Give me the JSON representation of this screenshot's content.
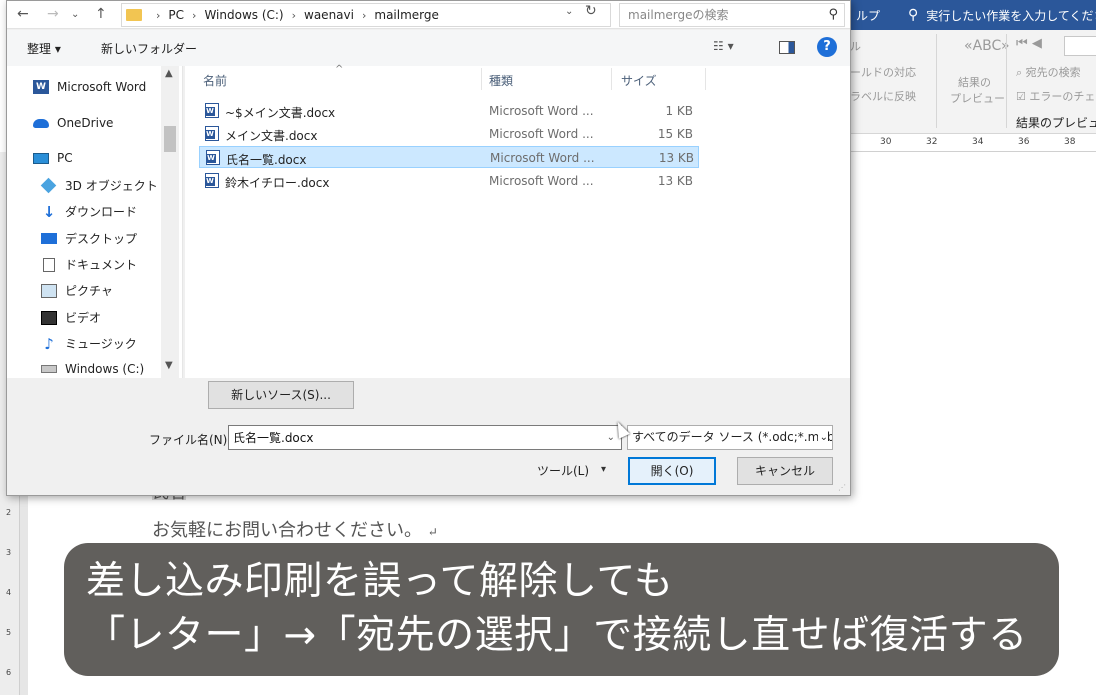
{
  "word": {
    "title_help": "ルプ",
    "tell_me": "実行したい作業を入力してくださ",
    "ribbon": {
      "rules": "ル",
      "match_fields": "ールドの対応",
      "update_labels": "ラベルに反映",
      "preview_results_l1": "結果の",
      "preview_results_l2": "プレビュー",
      "find_recipient": "宛先の検索",
      "check_errors": "エラーのチェ",
      "group_label": "結果のプレビュー"
    },
    "ruler": [
      "30",
      "32",
      "34",
      "36",
      "38"
    ],
    "vertical_ruler": [
      "2",
      "3",
      "4",
      "5",
      "6"
    ],
    "doc_line1_field": "氏名",
    "doc_line2": "お気軽にお問い合わせください。"
  },
  "dialog": {
    "breadcrumb": [
      "PC",
      "Windows (C:)",
      "waenavi",
      "mailmerge"
    ],
    "search_placeholder": "mailmergeの検索",
    "toolbar": {
      "organize": "整理 ▾",
      "new_folder": "新しいフォルダー",
      "view": "☷ ▾"
    },
    "nav_pane": [
      {
        "label": "Microsoft Word",
        "icon": "word-icon"
      },
      {
        "label": "OneDrive",
        "icon": "cloud-icon"
      },
      {
        "label": "PC",
        "icon": "pc-icon"
      },
      {
        "label": "3D オブジェクト",
        "icon": "cube-icon"
      },
      {
        "label": "ダウンロード",
        "icon": "download-icon"
      },
      {
        "label": "デスクトップ",
        "icon": "desktop-icon"
      },
      {
        "label": "ドキュメント",
        "icon": "document-icon"
      },
      {
        "label": "ピクチャ",
        "icon": "picture-icon"
      },
      {
        "label": "ビデオ",
        "icon": "video-icon"
      },
      {
        "label": "ミュージック",
        "icon": "music-icon"
      },
      {
        "label": "Windows (C:)",
        "icon": "drive-icon"
      }
    ],
    "columns": {
      "name": "名前",
      "type": "種類",
      "size": "サイズ"
    },
    "files": [
      {
        "name": "~$メイン文書.docx",
        "type": "Microsoft Word ...",
        "size": "1 KB",
        "selected": false
      },
      {
        "name": "メイン文書.docx",
        "type": "Microsoft Word ...",
        "size": "15 KB",
        "selected": false
      },
      {
        "name": "氏名一覧.docx",
        "type": "Microsoft Word ...",
        "size": "13 KB",
        "selected": true
      },
      {
        "name": "鈴木イチロー.docx",
        "type": "Microsoft Word ...",
        "size": "13 KB",
        "selected": false
      }
    ],
    "new_source_button": "新しいソース(S)...",
    "filename_label": "ファイル名(N):",
    "filename_value": "氏名一覧.docx",
    "filetype": "すべてのデータ ソース (*.odc;*.mdb",
    "tools": "ツール(L)",
    "open_button": "開く(O)",
    "cancel_button": "キャンセル"
  },
  "caption": {
    "line1": "差し込み印刷を誤って解除しても",
    "line2": "「レター」→「宛先の選択」で接続し直せば復活する"
  },
  "colors": {
    "word_blue": "#2b579a",
    "selection": "#cce8ff",
    "accent": "#0078d7"
  }
}
